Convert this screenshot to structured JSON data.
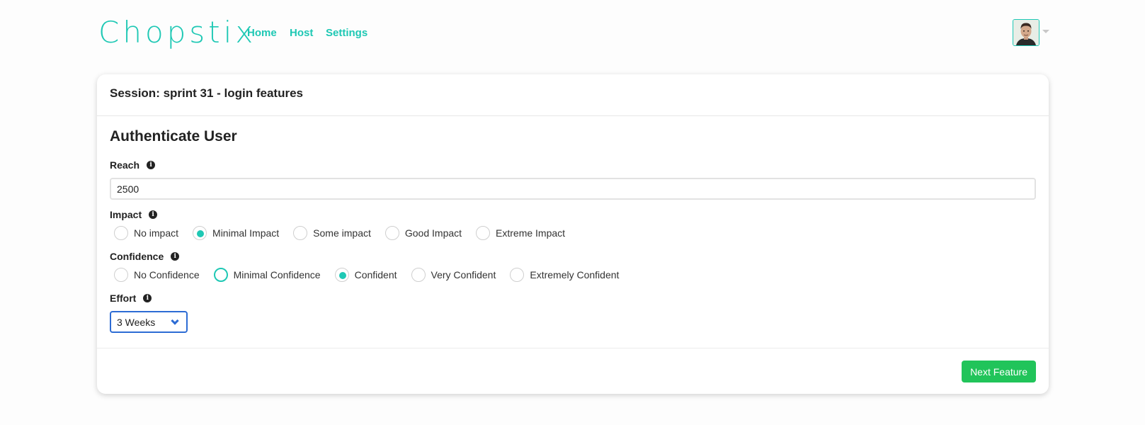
{
  "navbar": {
    "logo": "Chopstix",
    "links": [
      "Home",
      "Host",
      "Settings"
    ]
  },
  "session": {
    "title": "Session: sprint 31 - login features"
  },
  "feature": {
    "title": "Authenticate User",
    "reach": {
      "label": "Reach",
      "value": "2500"
    },
    "impact": {
      "label": "Impact",
      "options": [
        "No impact",
        "Minimal Impact",
        "Some impact",
        "Good Impact",
        "Extreme Impact"
      ],
      "selected": "Minimal Impact"
    },
    "confidence": {
      "label": "Confidence",
      "options": [
        "No Confidence",
        "Minimal Confidence",
        "Confident",
        "Very Confident",
        "Extremely Confident"
      ],
      "selected": "Confident",
      "focused": "Minimal Confidence"
    },
    "effort": {
      "label": "Effort",
      "selected": "3 Weeks"
    }
  },
  "footer": {
    "next_label": "Next Feature"
  },
  "colors": {
    "accent": "#1ec8b4",
    "primary_button": "#21c45a",
    "select_focus": "#2d6cd4"
  }
}
